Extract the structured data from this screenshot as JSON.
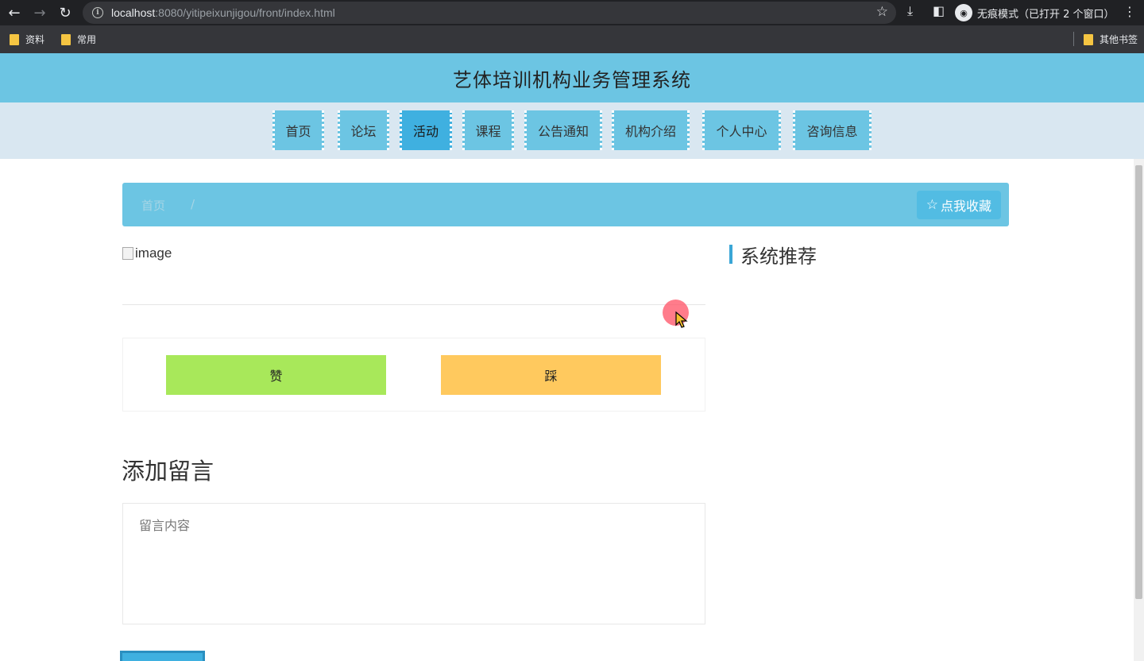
{
  "browser": {
    "url_host": "localhost",
    "url_rest": ":8080/yitipeixunjigou/front/index.html",
    "incognito_label": "无痕模式（已打开 2 个窗口）",
    "bookmarks": [
      "资料",
      "常用"
    ],
    "other_bookmarks": "其他书签"
  },
  "site": {
    "title": "艺体培训机构业务管理系统"
  },
  "nav": {
    "items": [
      "首页",
      "论坛",
      "活动",
      "课程",
      "公告通知",
      "机构介绍",
      "个人中心",
      "咨询信息"
    ],
    "active": "活动"
  },
  "breadcrumb": {
    "home": "首页",
    "separator": "/"
  },
  "favorite_button": "点我收藏",
  "detail": {
    "image_alt": "image",
    "like_label": "赞",
    "dislike_label": "踩"
  },
  "recommend": {
    "title": "系统推荐"
  },
  "comment": {
    "title": "添加留言",
    "placeholder": "留言内容"
  },
  "colors": {
    "header": "#6cc5e3",
    "nav_bg": "#d9e7f1",
    "nav_active": "#3fb0e0",
    "like": "#a8e85a",
    "dislike": "#ffc95e"
  }
}
